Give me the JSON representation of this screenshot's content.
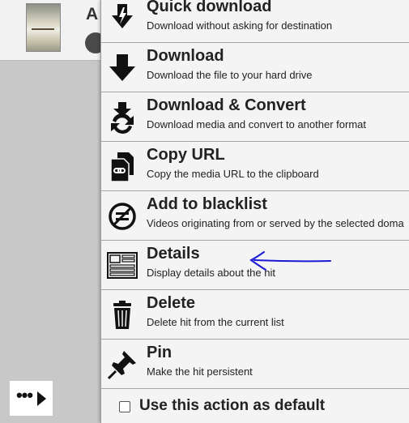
{
  "background": {
    "title_initial": "A"
  },
  "menu": {
    "items": [
      {
        "id": "quick-download",
        "label": "Quick download",
        "description": "Download without asking for destination",
        "icon": "quick-download-icon"
      },
      {
        "id": "download",
        "label": "Download",
        "description": "Download the file to your hard drive",
        "icon": "download-icon"
      },
      {
        "id": "download-convert",
        "label": "Download & Convert",
        "description": "Download media and convert to another format",
        "icon": "download-convert-icon"
      },
      {
        "id": "copy-url",
        "label": "Copy URL",
        "description": "Copy the media URL to the clipboard",
        "icon": "copy-url-icon"
      },
      {
        "id": "add-blacklist",
        "label": "Add to blacklist",
        "description": "Videos originating from or served by the selected doma",
        "icon": "blacklist-icon"
      },
      {
        "id": "details",
        "label": "Details",
        "description": "Display details about the hit",
        "icon": "details-icon"
      },
      {
        "id": "delete",
        "label": "Delete",
        "description": "Delete hit from the current list",
        "icon": "trash-icon"
      },
      {
        "id": "pin",
        "label": "Pin",
        "description": "Make the hit persistent",
        "icon": "pin-icon"
      }
    ],
    "default_checkbox": {
      "label": "Use this action as default",
      "checked": false
    }
  },
  "more_button": {
    "icon": "more-actions-icon"
  },
  "colors": {
    "annotation_arrow": "#1a1ad6",
    "menu_bg": "#f4f4f4",
    "divider": "#a6a6a6"
  }
}
